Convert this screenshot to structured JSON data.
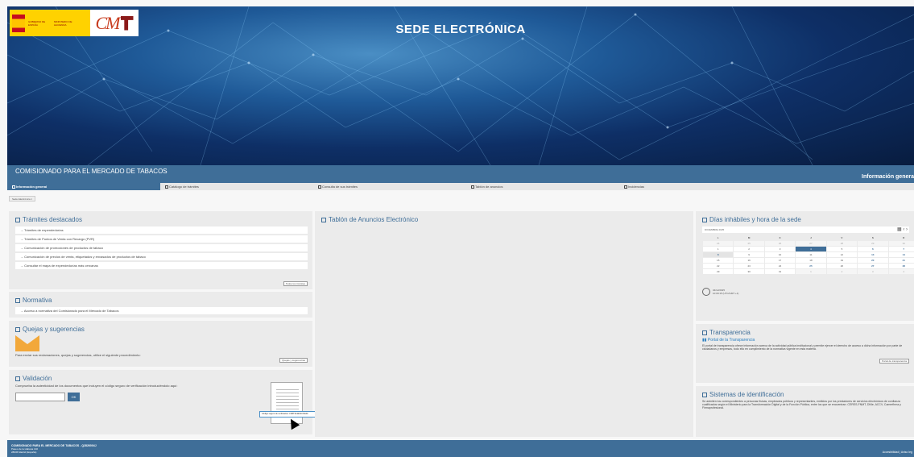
{
  "header": {
    "site_title": "SEDE ELECTRÓNICA",
    "gov_text": "GOBIERNO DE ESPAÑA",
    "ministry_text": "MINISTERIO DE HACIENDA",
    "cm_logo": "CM"
  },
  "titlebar": {
    "org_name": "COMISIONADO PARA EL MERCADO DE TABACOS",
    "info_link": "Información genera"
  },
  "nav": {
    "tabs": [
      {
        "label": "Información general"
      },
      {
        "label": "Catálogo de trámites"
      },
      {
        "label": "Consulta de sus trámites"
      },
      {
        "label": "Tablón de anuncios"
      },
      {
        "label": "Incidencias"
      }
    ]
  },
  "breadcrumb": {
    "label": "Sede Electrónica"
  },
  "tramites": {
    "title": "Trámites destacados",
    "items": [
      "→ Trámites de expendedurías",
      "→ Trámites de Puntos de Venta con Recargo (PVR)",
      "→ Comunicación de promociones de productos de tabaco",
      "→ Comunicación de precios de venta, etiquetados y envasados de productos de tabaco",
      "→ Consultar el mapa de expendedurías más cercanas"
    ],
    "more_label": "Todos los trámites"
  },
  "normativa": {
    "title": "Normativa",
    "items": [
      "→ Acceso a normativa del Comisionado para el Mercado de Tabacos"
    ]
  },
  "quejas": {
    "title": "Quejas y sugerencias",
    "text": "Para enviar sus reclamaciones, quejas y sugerencias, utilice el siguiente procedimiento:",
    "more_label": "Quejas y sugerencias"
  },
  "validacion": {
    "title": "Validación",
    "text": "Comprueba la autenticidad de los documentos que incluyen el código seguro de verificación introduciéndolo aquí:",
    "ok_label": "OK",
    "code_label": "Código seguro de verificación: FN8TSL9ESCX8A4F"
  },
  "tablon": {
    "title": "Tablón de Anuncios Electrónico"
  },
  "dias": {
    "title": "Días inhábiles y hora de la sede",
    "month_label": "DICIEMBRE 2025",
    "weekdays": [
      "L",
      "M",
      "X",
      "J",
      "V",
      "S",
      "D"
    ],
    "weeks": [
      [
        "24",
        "25",
        "26",
        "27",
        "28",
        "29",
        "30"
      ],
      [
        "1",
        "2",
        "3",
        "4",
        "5",
        "6",
        "7"
      ],
      [
        "8",
        "9",
        "10",
        "11",
        "12",
        "13",
        "14"
      ],
      [
        "15",
        "16",
        "17",
        "18",
        "19",
        "20",
        "21"
      ],
      [
        "22",
        "23",
        "24",
        "25",
        "26",
        "27",
        "28"
      ],
      [
        "29",
        "30",
        "31",
        "1",
        "2",
        "3",
        "4"
      ]
    ],
    "clock_date": "04/12/2025",
    "clock_time": "10:09:15 (UTC/GMT +1)"
  },
  "transparencia": {
    "title": "Transparencia",
    "logo_text": "Portal de la Transparencia",
    "text": "El portal de transparencia ofrece información acerca de la actividad pública institucional y permite ejercer el derecho de acceso a dicha información por parte de ciudadanos y empresas, todo ello en cumplimiento de la normativa vigente en esta materia.",
    "more_label": "Portal de transparencia"
  },
  "sistemas": {
    "title": "Sistemas de identificación",
    "text": "Se admiten los correspondientes a personas físicas, empleados públicos y representantes, emitidos por los prestadores de servicios electrónicos de confianza cualificados según el Ministerio para la Transformación Digital y de la Función Pública, entre los que se encuentran: CERES-FNMT, DNIe, ACCV, Camerfirma y Firmaprofesional."
  },
  "footer": {
    "org": "COMISIONADO PARA EL MERCADO DE TABACOS - Q2826004J",
    "addr1": "Paseo de la Habana 140",
    "addr2": "28036 Madrid (España)",
    "links": "Accesibilidad | Aviso leg"
  },
  "colors": {
    "primary": "#3f6e98",
    "panel": "#ebebeb",
    "accent_orange": "#f2a83a"
  }
}
